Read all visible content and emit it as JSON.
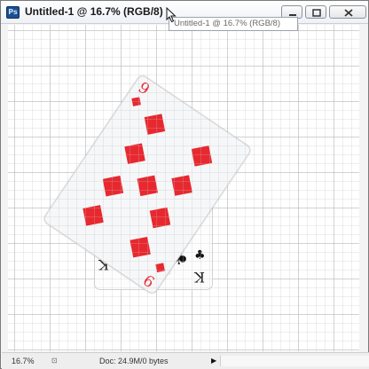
{
  "window": {
    "app_icon_text": "Ps",
    "title": "Untitled-1 @ 16.7% (RGB/8)",
    "tooltip": "Untitled-1 @ 16.7% (RGB/8)"
  },
  "canvas": {
    "front_card": {
      "rank": "9",
      "suit": "diamonds",
      "color": "#e8282f"
    },
    "back_card": {
      "rank": "K",
      "suit": "clubs",
      "color": "#222222"
    }
  },
  "status": {
    "zoom": "16.7%",
    "doc": "Doc: 24.9M/0 bytes",
    "arrow": "▶"
  },
  "icons": [
    "photoshop-icon",
    "minimize-icon",
    "maximize-icon",
    "close-icon",
    "cursor-icon",
    "diamond-icon",
    "club-icon"
  ]
}
